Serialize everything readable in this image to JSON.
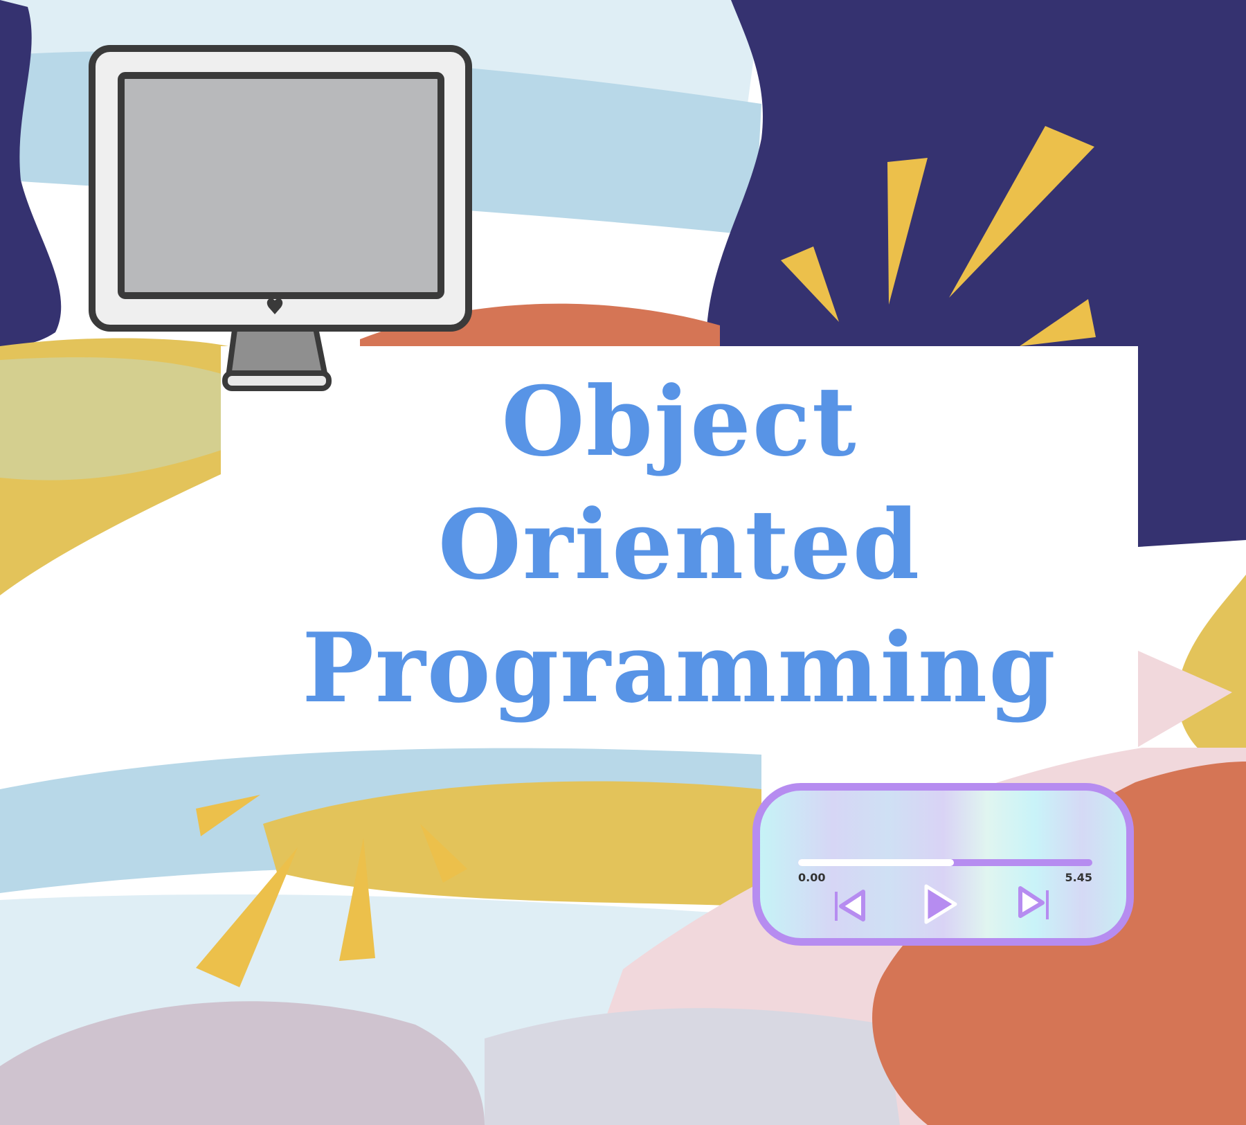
{
  "title": {
    "lines": [
      "Object",
      "Oriented",
      "Programming"
    ],
    "color": "#5894e6"
  },
  "player": {
    "time_start": "0.00",
    "time_end": "5.45",
    "progress_fraction": 0.53,
    "accent_color": "#b68cf0",
    "controls": [
      {
        "name": "previous",
        "icon": "skip-back-icon"
      },
      {
        "name": "play",
        "icon": "play-icon"
      },
      {
        "name": "next",
        "icon": "skip-forward-icon"
      }
    ]
  },
  "illustration": {
    "icon": "desktop-monitor-icon"
  },
  "colors": {
    "navy": "#353270",
    "light_blue": "#b8d8e8",
    "mustard": "#e3c35a",
    "orange": "#d57555",
    "pink": "#f1d8dc",
    "mauve": "#cfc3cf",
    "spark_yellow": "#ecc04b"
  }
}
